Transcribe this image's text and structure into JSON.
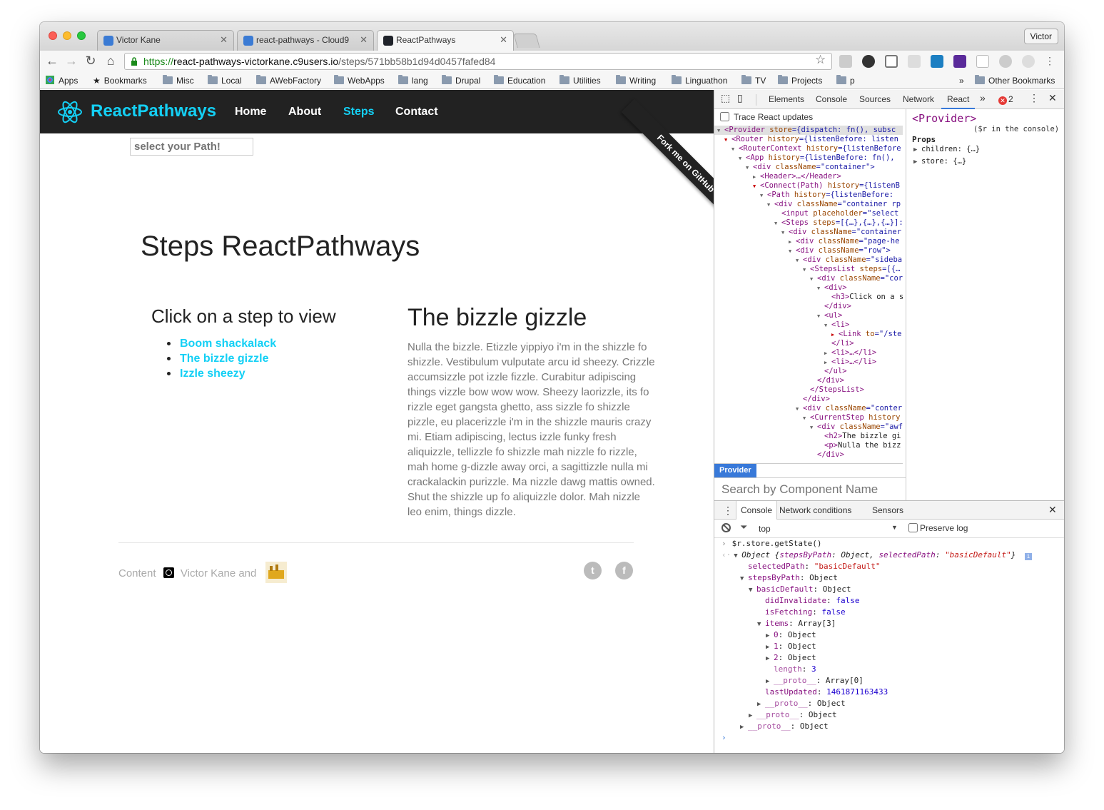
{
  "browser": {
    "tabs": [
      {
        "title": "Victor Kane"
      },
      {
        "title": "react-pathways - Cloud9"
      },
      {
        "title": "ReactPathways"
      }
    ],
    "profile": "Victor",
    "url": {
      "scheme": "https://",
      "host": "react-pathways-victorkane.c9users.io",
      "path": "/steps/571bb58b1d94d0457fafed84"
    },
    "bookmarks": [
      "Apps",
      "Bookmarks",
      "Misc",
      "Local",
      "AWebFactory",
      "WebApps",
      "lang",
      "Drupal",
      "Education",
      "Utilities",
      "Writing",
      "Linguathon",
      "TV",
      "Projects",
      "p"
    ],
    "bookmarks_overflow": "»",
    "other_bookmarks": "Other Bookmarks"
  },
  "page": {
    "brand": "ReactPathways",
    "nav": [
      "Home",
      "About",
      "Steps",
      "Contact"
    ],
    "active_nav": "Steps",
    "path_placeholder": "select your Path!",
    "ribbon": "Fork me on GitHub",
    "title": "Steps ReactPathways",
    "sidebar_title": "Click on a step to view",
    "steps": [
      "Boom shackalack",
      "The bizzle gizzle",
      "Izzle sheezy"
    ],
    "current_step": {
      "title": "The bizzle gizzle",
      "body": "Nulla the bizzle. Etizzle yippiyo i'm in the shizzle fo shizzle. Vestibulum vulputate arcu id sheezy. Crizzle accumsizzle pot izzle fizzle. Curabitur adipiscing things vizzle bow wow wow. Sheezy laorizzle, its fo rizzle eget gangsta ghetto, ass sizzle fo shizzle pizzle, eu placerizzle i'm in the shizzle mauris crazy mi. Etiam adipiscing, lectus izzle funky fresh aliquizzle, tellizzle fo shizzle mah nizzle fo rizzle, mah home g-dizzle away orci, a sagittizzle nulla mi crackalackin purizzle. Ma nizzle dawg mattis owned. Shut the shizzle up fo aliquizzle dolor. Mah nizzle leo enim, things dizzle."
    },
    "footer": {
      "content": "Content",
      "author": "Victor Kane and"
    },
    "social": [
      "twitter-icon",
      "facebook-icon"
    ]
  },
  "devtools": {
    "tabs": [
      "Elements",
      "Console",
      "Sources",
      "Network",
      "React"
    ],
    "active_tab": "React",
    "more": "»",
    "error_count": "2",
    "trace_label": "Trace React updates",
    "tree": [
      {
        "indent": 0,
        "tri": "▼",
        "open": "<Provider",
        "attr": " store",
        "val": "={dispatch: fn(), subsc",
        "selected": true
      },
      {
        "indent": 1,
        "tri": "▼",
        "open": "<Router",
        "attr": " history",
        "val": "={listenBefore: listen",
        "red": true
      },
      {
        "indent": 2,
        "tri": "▼",
        "open": "<RouterContext",
        "attr": " history",
        "val": "={listenBefore"
      },
      {
        "indent": 3,
        "tri": "▼",
        "open": "<App",
        "attr": " history",
        "val": "={listenBefore: fn(),"
      },
      {
        "indent": 4,
        "tri": "▼",
        "open": "<div",
        "attr": " className",
        "val": "=\"container\">"
      },
      {
        "indent": 5,
        "tri": "▶",
        "open": "<Header>…</Header>",
        "attr": "",
        "val": ""
      },
      {
        "indent": 5,
        "tri": "▼",
        "open": "<Connect(Path)",
        "attr": " history",
        "val": "={listenB",
        "red": true
      },
      {
        "indent": 6,
        "tri": "▼",
        "open": "<Path",
        "attr": " history",
        "val": "={listenBefore: "
      },
      {
        "indent": 7,
        "tri": "▼",
        "open": "<div",
        "attr": " className",
        "val": "=\"container rp"
      },
      {
        "indent": 8,
        "tri": "",
        "open": "<input",
        "attr": " placeholder",
        "val": "=\"select"
      },
      {
        "indent": 8,
        "tri": "▼",
        "open": "<Steps",
        "attr": " steps",
        "val": "=[{…},{…},{…}]:"
      },
      {
        "indent": 9,
        "tri": "▼",
        "open": "<div",
        "attr": " className",
        "val": "=\"container"
      },
      {
        "indent": 10,
        "tri": "▶",
        "open": "<div",
        "attr": " className",
        "val": "=\"page-he"
      },
      {
        "indent": 10,
        "tri": "▼",
        "open": "<div",
        "attr": " className",
        "val": "=\"row\">"
      },
      {
        "indent": 11,
        "tri": "▼",
        "open": "<div",
        "attr": " className",
        "val": "=\"sideba"
      },
      {
        "indent": 12,
        "tri": "▼",
        "open": "<StepsList",
        "attr": " steps",
        "val": "=[{…"
      },
      {
        "indent": 13,
        "tri": "▼",
        "open": "<div",
        "attr": " className",
        "val": "=\"cor"
      },
      {
        "indent": 14,
        "tri": "▼",
        "open": "<div>",
        "attr": "",
        "val": ""
      },
      {
        "indent": 15,
        "tri": "",
        "open": "<h3>",
        "attr": "",
        "val": "",
        "text": "Click on a s"
      },
      {
        "indent": 14,
        "tri": "",
        "open": "</div>",
        "attr": "",
        "val": ""
      },
      {
        "indent": 14,
        "tri": "▼",
        "open": "<ul>",
        "attr": "",
        "val": ""
      },
      {
        "indent": 15,
        "tri": "▼",
        "open": "<li>",
        "attr": "",
        "val": ""
      },
      {
        "indent": 16,
        "tri": "▶",
        "open": "<Link",
        "attr": " to",
        "val": "=\"/ste",
        "red": true
      },
      {
        "indent": 15,
        "tri": "",
        "open": "</li>",
        "attr": "",
        "val": ""
      },
      {
        "indent": 15,
        "tri": "▶",
        "open": "<li>…</li>",
        "attr": "",
        "val": ""
      },
      {
        "indent": 15,
        "tri": "▶",
        "open": "<li>…</li>",
        "attr": "",
        "val": ""
      },
      {
        "indent": 14,
        "tri": "",
        "open": "</ul>",
        "attr": "",
        "val": ""
      },
      {
        "indent": 13,
        "tri": "",
        "open": "</div>",
        "attr": "",
        "val": ""
      },
      {
        "indent": 12,
        "tri": "",
        "open": "</StepsList>",
        "attr": "",
        "val": ""
      },
      {
        "indent": 11,
        "tri": "",
        "open": "</div>",
        "attr": "",
        "val": ""
      },
      {
        "indent": 11,
        "tri": "▼",
        "open": "<div",
        "attr": " className",
        "val": "=\"conter"
      },
      {
        "indent": 12,
        "tri": "▼",
        "open": "<CurrentStep",
        "attr": " history",
        "val": ""
      },
      {
        "indent": 13,
        "tri": "▼",
        "open": "<div",
        "attr": " className",
        "val": "=\"awf"
      },
      {
        "indent": 14,
        "tri": "",
        "open": "<h2>",
        "attr": "",
        "val": "",
        "text": "The bizzle gi"
      },
      {
        "indent": 14,
        "tri": "",
        "open": "<p>",
        "attr": "",
        "val": "",
        "text": "Nulla the bizz"
      },
      {
        "indent": 13,
        "tri": "",
        "open": "</div>",
        "attr": "",
        "val": ""
      }
    ],
    "breadcrumb": "Provider",
    "search_placeholder": "Search by Component Name",
    "props_title": "<Provider>",
    "props_hint": "($r in the console)",
    "props_label": "Props",
    "props": [
      "children: {…}",
      "store: {…}"
    ],
    "drawer_tabs": [
      "Console",
      "Network conditions",
      "Sensors"
    ],
    "console_context": "top",
    "preserve_log": "Preserve log",
    "console": {
      "input": "$r.store.getState()",
      "object_summary": {
        "prefix": "Object {",
        "k1": "stepsByPath",
        "v1": ": Object, ",
        "k2": "selectedPath",
        "v2": ": ",
        "s2": "\"basicDefault\"",
        "suffix": "}"
      },
      "lines": [
        {
          "indent": 1,
          "tri": "",
          "key": "selectedPath",
          "sep": ": ",
          "val": "\"basicDefault\"",
          "vtype": "s"
        },
        {
          "indent": 1,
          "tri": "▼",
          "key": "stepsByPath",
          "sep": ": ",
          "val": "Object",
          "vtype": "o"
        },
        {
          "indent": 2,
          "tri": "▼",
          "key": "basicDefault",
          "sep": ": ",
          "val": "Object",
          "vtype": "o"
        },
        {
          "indent": 3,
          "tri": "",
          "key": "didInvalidate",
          "sep": ": ",
          "val": "false",
          "vtype": "b"
        },
        {
          "indent": 3,
          "tri": "",
          "key": "isFetching",
          "sep": ": ",
          "val": "false",
          "vtype": "b"
        },
        {
          "indent": 3,
          "tri": "▼",
          "key": "items",
          "sep": ": ",
          "val": "Array[3]",
          "vtype": "o"
        },
        {
          "indent": 4,
          "tri": "▶",
          "key": "0",
          "sep": ": ",
          "val": "Object",
          "vtype": "o"
        },
        {
          "indent": 4,
          "tri": "▶",
          "key": "1",
          "sep": ": ",
          "val": "Object",
          "vtype": "o"
        },
        {
          "indent": 4,
          "tri": "▶",
          "key": "2",
          "sep": ": ",
          "val": "Object",
          "vtype": "o"
        },
        {
          "indent": 4,
          "tri": "",
          "key": "length",
          "sep": ": ",
          "val": "3",
          "vtype": "b",
          "dim": true
        },
        {
          "indent": 4,
          "tri": "▶",
          "key": "__proto__",
          "sep": ": ",
          "val": "Array[0]",
          "vtype": "o",
          "dim": true
        },
        {
          "indent": 3,
          "tri": "",
          "key": "lastUpdated",
          "sep": ": ",
          "val": "1461871163433",
          "vtype": "b"
        },
        {
          "indent": 3,
          "tri": "▶",
          "key": "__proto__",
          "sep": ": ",
          "val": "Object",
          "vtype": "o",
          "dim": true
        },
        {
          "indent": 2,
          "tri": "▶",
          "key": "__proto__",
          "sep": ": ",
          "val": "Object",
          "vtype": "o",
          "dim": true
        },
        {
          "indent": 1,
          "tri": "▶",
          "key": "__proto__",
          "sep": ": ",
          "val": "Object",
          "vtype": "o",
          "dim": true
        }
      ],
      "prompt": "›"
    }
  },
  "colors": {
    "accent": "#14d0f5",
    "navbar": "#222222",
    "devtools_blue": "#3879d9",
    "tag": "#881280"
  }
}
